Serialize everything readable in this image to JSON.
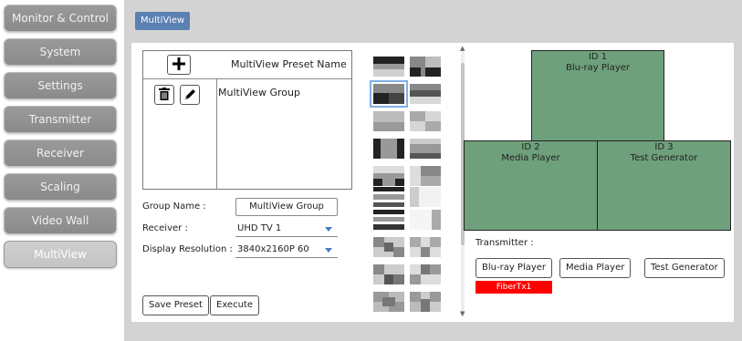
{
  "sidebar": {
    "items": [
      {
        "label": "Monitor & Control",
        "active": false
      },
      {
        "label": "System",
        "active": false
      },
      {
        "label": "Settings",
        "active": false
      },
      {
        "label": "Transmitter",
        "active": false
      },
      {
        "label": "Receiver",
        "active": false
      },
      {
        "label": "Scaling",
        "active": false
      },
      {
        "label": "Video Wall",
        "active": false
      },
      {
        "label": "MultiView",
        "active": true
      }
    ]
  },
  "header": {
    "tab_label": "MultiView"
  },
  "preset": {
    "column_title": "MultiView Preset Name",
    "add_icon": "plus-icon",
    "delete_icon": "trash-icon",
    "edit_icon": "pencil-icon",
    "rows": [
      "MultiView Group"
    ]
  },
  "form": {
    "group_name_label": "Group Name :",
    "group_name_value": "MultiView Group",
    "receiver_label": "Receiver :",
    "receiver_value": "UHD TV 1",
    "resolution_label": "Display Resolution :",
    "resolution_value": "3840x2160P 60",
    "save_label": "Save Preset",
    "execute_label": "Execute"
  },
  "preview": {
    "windows": [
      {
        "id": "ID 1",
        "name": "Blu-ray Player"
      },
      {
        "id": "ID 2",
        "name": "Media Player"
      },
      {
        "id": "ID 3",
        "name": "Test Generator"
      }
    ],
    "transmitter_label": "Transmitter :",
    "transmitters": [
      "Blu-ray Player",
      "Media Player",
      "Test Generator"
    ],
    "status_label": "FiberTx1"
  },
  "colors": {
    "accent": "#5b80b2",
    "window_fill": "#6fa07c",
    "status_red": "#ff0000"
  }
}
